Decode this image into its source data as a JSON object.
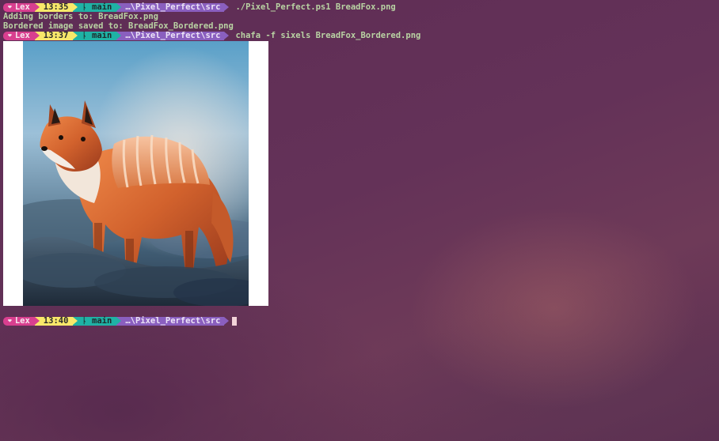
{
  "prompt": {
    "user": "Lex",
    "branch": "main",
    "path": "…\\Pixel_Perfect\\src"
  },
  "lines": [
    {
      "time": "13:35",
      "command": "./Pixel_Perfect.ps1 BreadFox.png"
    },
    {
      "time": "13:37",
      "command": "chafa -f sixels BreadFox_Bordered.png"
    },
    {
      "time": "13:40",
      "command": ""
    }
  ],
  "output": [
    "Adding borders to: BreadFox.png",
    "Bordered image saved to: BreadFox_Bordered.png"
  ],
  "icons": {
    "user": "heart-icon",
    "git": "git-branch-icon"
  },
  "colors": {
    "user_segment": "#d83f8f",
    "time_segment": "#f8e86a",
    "git_segment": "#1fb2a5",
    "path_segment": "#8a5fbf",
    "output_text": "#b9d3a3"
  }
}
